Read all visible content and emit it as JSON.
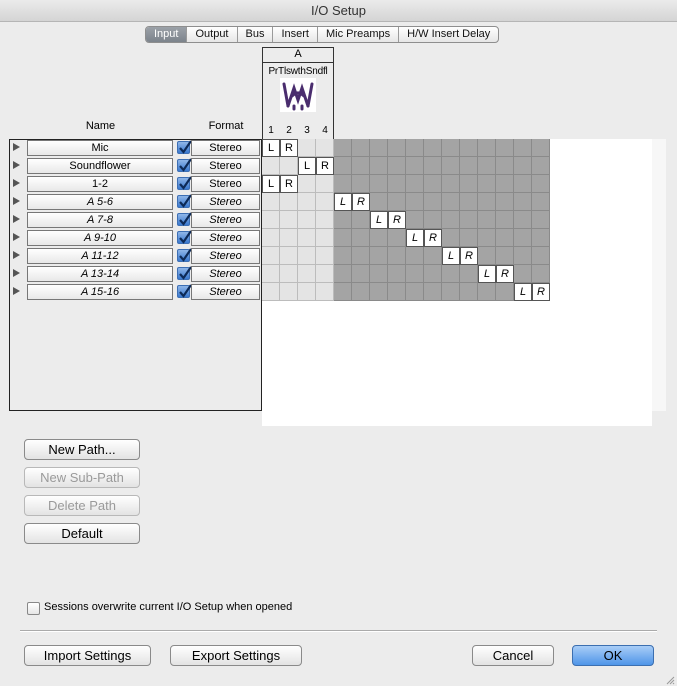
{
  "window": {
    "title": "I/O Setup"
  },
  "tabs": [
    {
      "label": "Input",
      "active": true
    },
    {
      "label": "Output",
      "active": false
    },
    {
      "label": "Bus",
      "active": false
    },
    {
      "label": "Insert",
      "active": false
    },
    {
      "label": "Mic Preamps",
      "active": false
    },
    {
      "label": "H/W Insert Delay",
      "active": false
    }
  ],
  "headers": {
    "name": "Name",
    "format": "Format"
  },
  "hardware": {
    "group": "A",
    "device": "PrTlswthSndfl",
    "channels": [
      "1",
      "2",
      "3",
      "4"
    ]
  },
  "paths": [
    {
      "name": "Mic",
      "format": "Stereo",
      "italic": false,
      "checked": true,
      "start": 0
    },
    {
      "name": "Soundflower",
      "format": "Stereo",
      "italic": false,
      "checked": true,
      "start": 2
    },
    {
      "name": "1-2",
      "format": "Stereo",
      "italic": false,
      "checked": true,
      "start": 0
    },
    {
      "name": "A 5-6",
      "format": "Stereo",
      "italic": true,
      "checked": true,
      "start": 4
    },
    {
      "name": "A 7-8",
      "format": "Stereo",
      "italic": true,
      "checked": true,
      "start": 6
    },
    {
      "name": "A 9-10",
      "format": "Stereo",
      "italic": true,
      "checked": true,
      "start": 8
    },
    {
      "name": "A 11-12",
      "format": "Stereo",
      "italic": true,
      "checked": true,
      "start": 10
    },
    {
      "name": "A 13-14",
      "format": "Stereo",
      "italic": true,
      "checked": true,
      "start": 12
    },
    {
      "name": "A 15-16",
      "format": "Stereo",
      "italic": true,
      "checked": true,
      "start": 14
    }
  ],
  "matrix": {
    "columns": 16,
    "light_columns": 4,
    "left_label": "L",
    "right_label": "R"
  },
  "buttons": {
    "new_path": "New Path...",
    "new_sub_path": "New Sub-Path",
    "delete_path": "Delete Path",
    "default": "Default",
    "import": "Import Settings",
    "export": "Export Settings",
    "cancel": "Cancel",
    "ok": "OK"
  },
  "options": {
    "sessions_overwrite": "Sessions overwrite current I/O Setup when opened",
    "sessions_overwrite_checked": false
  },
  "colors": {
    "tab_active": "#8a9098",
    "default_button": "#4f95e8",
    "checkbox": "#3a79cf"
  }
}
